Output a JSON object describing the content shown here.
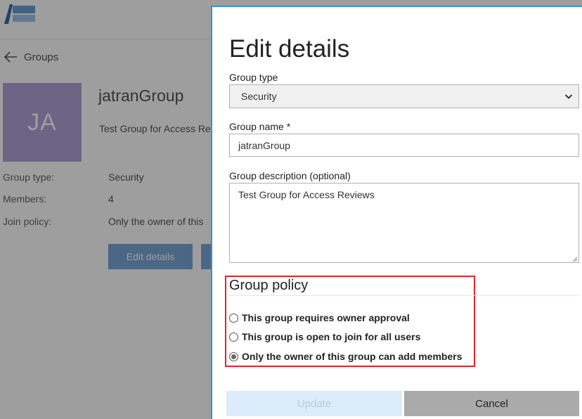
{
  "background": {
    "back_label": "Groups",
    "avatar_initials": "JA",
    "group_name": "jatranGroup",
    "group_description": "Test Group for Access Re",
    "properties": [
      {
        "label": "Group type:",
        "value": "Security"
      },
      {
        "label": "Members:",
        "value": "4"
      },
      {
        "label": "Join policy:",
        "value": "Only the owner of this"
      }
    ],
    "edit_button_label": "Edit details"
  },
  "dialog": {
    "title": "Edit details",
    "group_type_label": "Group type",
    "group_type_value": "Security",
    "group_name_label": "Group name *",
    "group_name_value": "jatranGroup",
    "group_description_label": "Group description (optional)",
    "group_description_value": "Test Group for Access Reviews",
    "policy_title": "Group policy",
    "policy_options": [
      {
        "label": "This group requires owner approval",
        "checked": false
      },
      {
        "label": "This group is open to join for all users",
        "checked": false
      },
      {
        "label": "Only the owner of this group can add members",
        "checked": true
      }
    ],
    "update_label": "Update",
    "cancel_label": "Cancel"
  },
  "colors": {
    "accent_border": "#3a8fd8",
    "highlight_box": "#e0242d",
    "avatar_bg": "#b1a3d8",
    "overlay": "rgba(0,0,0,0.38)"
  },
  "icons": {
    "back": "arrow-left-icon",
    "select": "chevron-down-icon",
    "logo": "app-logo"
  }
}
